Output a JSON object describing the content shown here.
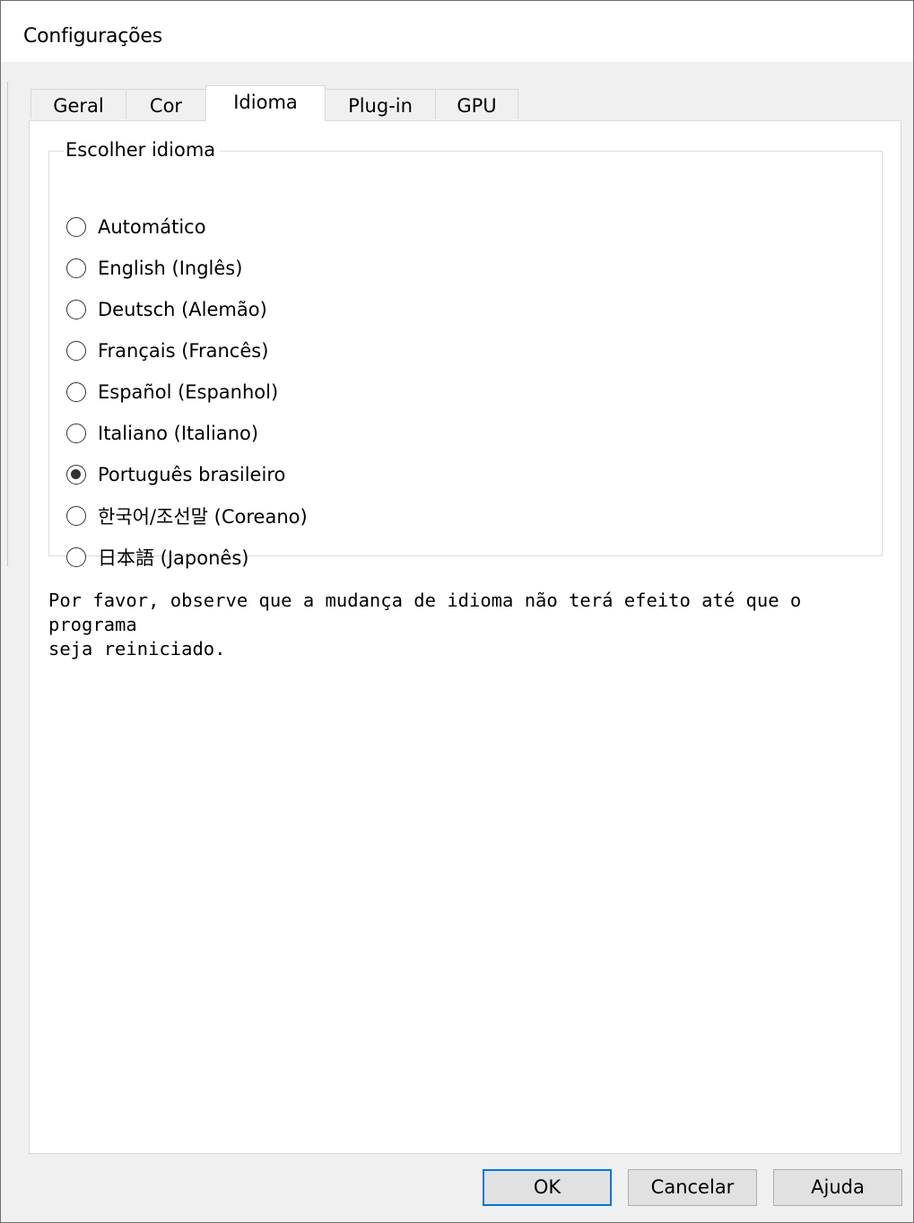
{
  "window": {
    "title": "Configurações"
  },
  "tabs": [
    {
      "label": "Geral",
      "active": false
    },
    {
      "label": "Cor",
      "active": false
    },
    {
      "label": "Idioma",
      "active": true
    },
    {
      "label": "Plug-in",
      "active": false
    },
    {
      "label": "GPU",
      "active": false
    }
  ],
  "language_group": {
    "legend": "Escolher idioma",
    "options": [
      {
        "label": "Automático",
        "checked": false
      },
      {
        "label": "English (Inglês)",
        "checked": false
      },
      {
        "label": "Deutsch (Alemão)",
        "checked": false
      },
      {
        "label": "Français (Francês)",
        "checked": false
      },
      {
        "label": "Español (Espanhol)",
        "checked": false
      },
      {
        "label": "Italiano (Italiano)",
        "checked": false
      },
      {
        "label": "Português brasileiro",
        "checked": true
      },
      {
        "label": "한국어/조선말 (Coreano)",
        "checked": false
      },
      {
        "label": "日本語 (Japonês)",
        "checked": false
      }
    ]
  },
  "note": {
    "line1": "Por favor, observe que a mudança de idioma não terá efeito até que o programa",
    "line2": "seja reiniciado."
  },
  "buttons": {
    "ok": "OK",
    "cancel": "Cancelar",
    "help": "Ajuda"
  },
  "colors": {
    "focus_border": "#0078d7",
    "dialog_bg": "#f0f0f0",
    "panel_bg": "#ffffff"
  }
}
